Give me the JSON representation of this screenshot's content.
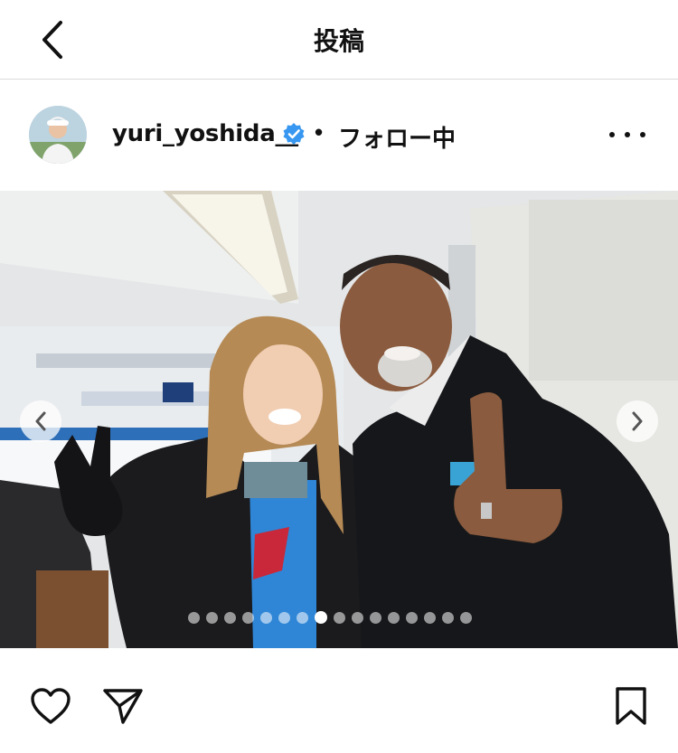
{
  "topbar": {
    "title": "投稿",
    "back_icon": "chevron-left-icon"
  },
  "post": {
    "username": "yuri_yoshida__",
    "verified": true,
    "separator": "•",
    "follow_status": "フォロー中",
    "more_icon": "more-horizontal-icon"
  },
  "carousel": {
    "total_slides": 16,
    "current_slide": 8,
    "prev_icon": "chevron-left-icon",
    "next_icon": "chevron-right-icon"
  },
  "actions": {
    "like_icon": "heart-icon",
    "share_icon": "send-icon",
    "save_icon": "bookmark-icon"
  },
  "colors": {
    "verified_blue": "#3897f0",
    "divider": "#dbdbdb",
    "text": "#111111"
  }
}
